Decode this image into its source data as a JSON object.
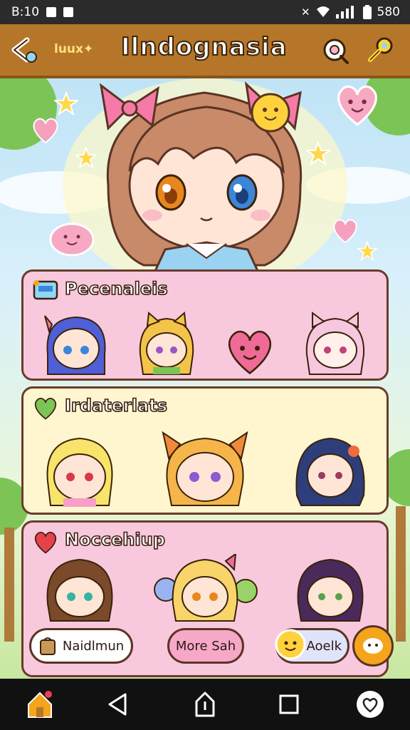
{
  "status_bar": {
    "time": "B:10",
    "battery": "580"
  },
  "header": {
    "subtitle": "luux✦",
    "title": "Ilndognasia"
  },
  "sections": [
    {
      "title": "Pecenaleis"
    },
    {
      "title": "Irdaterlats"
    },
    {
      "title": "Noccehiup"
    }
  ],
  "buttons": {
    "left": "Naidlmun",
    "middle": "More Sah",
    "right": "Aoelk"
  },
  "colors": {
    "header": "#b5762a",
    "card_pink": "#f8c9dd",
    "card_yellow": "#fff6cf",
    "accent_orange": "#f4a51c"
  },
  "icons": [
    "back-icon",
    "target-icon",
    "key-icon",
    "home-icon",
    "triangle-back-icon",
    "upload-icon",
    "square-icon",
    "heart-icon"
  ]
}
